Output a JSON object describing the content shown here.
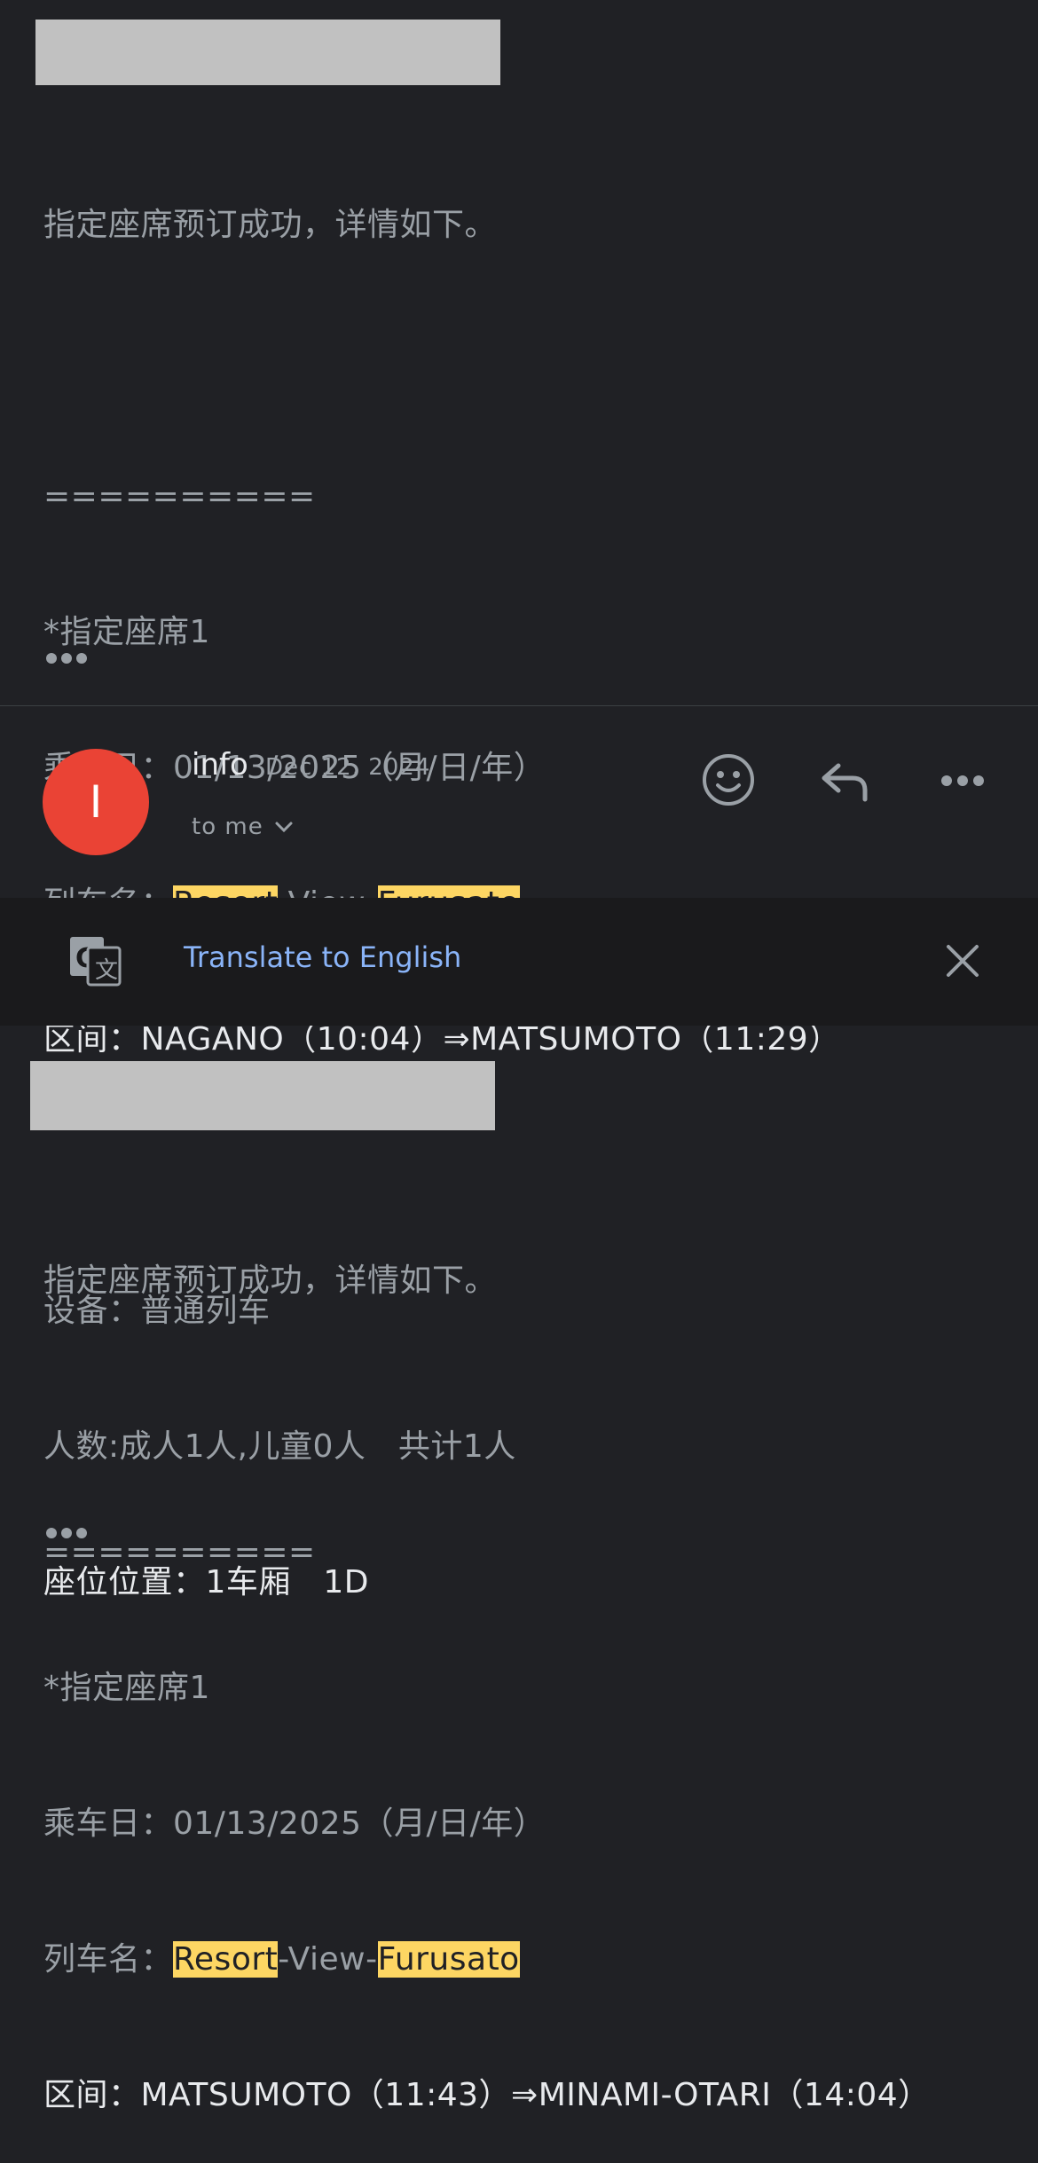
{
  "message1": {
    "lines": [
      "指定座席预订成功，详情如下。",
      "",
      "==========",
      "*指定座席1",
      "乘车日：01/13/2025（月/日/年）"
    ],
    "train_label": "列车名：",
    "train_part1": "Resort",
    "train_part2": "-View-",
    "train_part3": "Furusato",
    "route": "区间：NAGANO（10:04）⇒MATSUMOTO（11:29）",
    "equipment": "设备：普通列车",
    "passengers": "人数:成人1人,儿童0人　共计1人",
    "seat": "座位位置：1车厢　1D"
  },
  "header": {
    "avatar_letter": "I",
    "sender": "info",
    "date": "Dec 12, 2024",
    "to": "to me"
  },
  "translate": {
    "label": "Translate to English"
  },
  "message2": {
    "lines": [
      "指定座席预订成功，详情如下。",
      "",
      "==========",
      "*指定座席1",
      "乘车日：01/13/2025（月/日/年）"
    ],
    "train_label": "列车名：",
    "train_part1": "Resort",
    "train_part2": "-View-",
    "train_part3": "Furusato",
    "route": "区间：MATSUMOTO（11:43）⇒MINAMI-OTARI（14:04）"
  },
  "colors": {
    "background": "#202125",
    "avatar": "#ea4335",
    "highlight": "#fdd663",
    "link": "#8ab4f8"
  }
}
